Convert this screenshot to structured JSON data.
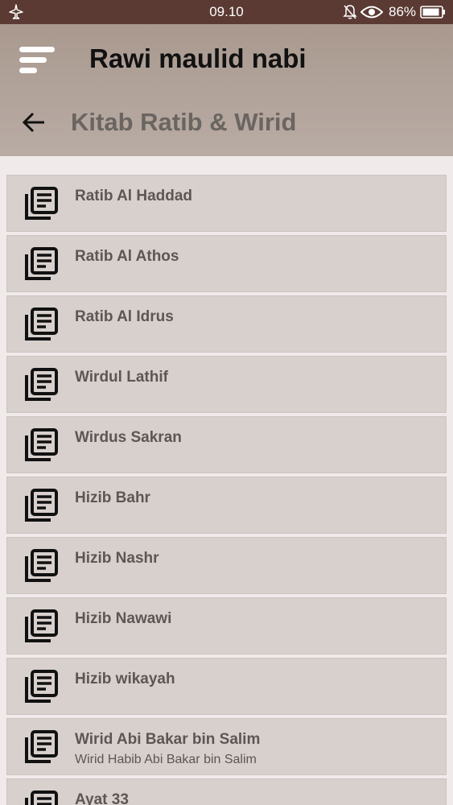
{
  "status_bar": {
    "time": "09.10",
    "battery": "86%"
  },
  "app_bar": {
    "app_title": "Rawi maulid nabi",
    "page_title": "Kitab Ratib & Wirid"
  },
  "list": {
    "items": [
      {
        "title": "Ratib Al Haddad",
        "subtitle": ""
      },
      {
        "title": "Ratib Al Athos",
        "subtitle": ""
      },
      {
        "title": "Ratib Al Idrus",
        "subtitle": ""
      },
      {
        "title": "Wirdul Lathif",
        "subtitle": ""
      },
      {
        "title": "Wirdus Sakran",
        "subtitle": ""
      },
      {
        "title": "Hizib Bahr",
        "subtitle": ""
      },
      {
        "title": "Hizib Nashr",
        "subtitle": ""
      },
      {
        "title": "Hizib Nawawi",
        "subtitle": ""
      },
      {
        "title": "Hizib wikayah",
        "subtitle": ""
      },
      {
        "title": "Wirid Abi Bakar bin Salim",
        "subtitle": "Wirid Habib Abi Bakar bin Salim"
      },
      {
        "title": "Ayat 33",
        "subtitle": ""
      }
    ]
  },
  "icons": {
    "menu": "menu-icon",
    "back": "arrow-back-icon",
    "item": "library-books-icon"
  }
}
